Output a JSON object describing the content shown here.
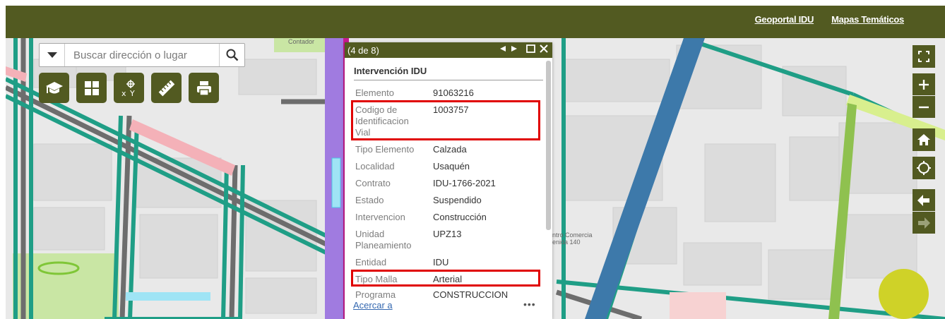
{
  "header": {
    "links": [
      "Geoportal IDU",
      "Mapas Temáticos"
    ]
  },
  "search": {
    "placeholder": "Buscar dirección o lugar"
  },
  "tools": [
    "grad-cap-icon",
    "grid-icon",
    "xy-coordinates-icon",
    "ruler-icon",
    "print-icon"
  ],
  "map_labels": {
    "contador": "Contador",
    "centro_line1": "ntro Comercia",
    "centro_line2": "enida 140"
  },
  "popup": {
    "counter": "(4 de 8)",
    "title": "Intervención IDU",
    "fields": [
      {
        "label": "Elemento",
        "value": "91063216"
      },
      {
        "label": "Codigo de Identificacion Vial",
        "value": "1003757"
      },
      {
        "label": "Tipo Elemento",
        "value": "Calzada"
      },
      {
        "label": "Localidad",
        "value": "Usaquén"
      },
      {
        "label": "Contrato",
        "value": "IDU-1766-2021"
      },
      {
        "label": "Estado",
        "value": "Suspendido"
      },
      {
        "label": "Intervencion",
        "value": "Construcción"
      },
      {
        "label": "Unidad Planeamiento",
        "value": "UPZ13"
      },
      {
        "label": "Entidad",
        "value": "IDU"
      },
      {
        "label": "Tipo Malla",
        "value": "Arterial"
      },
      {
        "label": "Programa",
        "value": "CONSTRUCCION"
      }
    ],
    "zoom_link": "Acercar a",
    "more": "•••"
  },
  "colors": {
    "brand": "#525a21",
    "highlight": "#e00000",
    "fab": "#cfd228",
    "link": "#3468b0"
  }
}
